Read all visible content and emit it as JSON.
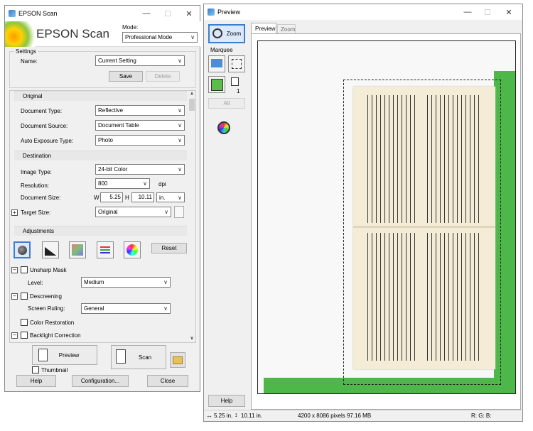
{
  "scan_window": {
    "title": "EPSON Scan",
    "logo_text": "EPSON Scan",
    "mode_label": "Mode:",
    "mode_value": "Professional Mode",
    "settings_label": "Settings",
    "name_label": "Name:",
    "name_value": "Current Setting",
    "save_label": "Save",
    "delete_label": "Delete",
    "original_section": "Original",
    "document_type_label": "Document Type:",
    "document_type_value": "Reflective",
    "document_source_label": "Document Source:",
    "document_source_value": "Document Table",
    "auto_exposure_label": "Auto Exposure Type:",
    "auto_exposure_value": "Photo",
    "destination_section": "Destination",
    "image_type_label": "Image Type:",
    "image_type_value": "24-bit Color",
    "resolution_label": "Resolution:",
    "resolution_value": "800",
    "dpi_label": "dpi",
    "document_size_label": "Document Size:",
    "w_label": "W",
    "width_value": "5.25",
    "h_label": "H",
    "height_value": "10.11",
    "unit_value": "in.",
    "target_size_label": "Target Size:",
    "target_size_value": "Original",
    "adjustments_section": "Adjustments",
    "reset_label": "Reset",
    "unsharp_mask_label": "Unsharp Mask",
    "level_label": "Level:",
    "level_value": "Medium",
    "descreening_label": "Descreening",
    "screen_ruling_label": "Screen Ruling:",
    "screen_ruling_value": "General",
    "color_restoration_label": "Color Restoration",
    "backlight_correction_label": "Backlight Correction",
    "preview_label": "Preview",
    "scan_label": "Scan",
    "thumbnail_label": "Thumbnail",
    "help_label": "Help",
    "configuration_label": "Configuration...",
    "close_label": "Close"
  },
  "preview_window": {
    "title": "Preview",
    "zoom_button_label": "Zoom",
    "marquee_label": "Marquee",
    "marquee_count": "1",
    "all_label": "All",
    "tab_preview": "Preview",
    "tab_zoom": "Zoom",
    "help_label": "Help",
    "status_size": "5.25 in.",
    "status_height": "10.11 in.",
    "status_pixels": "4200 x 8086 pixels 97.16 MB",
    "status_rgb": "R: G: B:"
  }
}
